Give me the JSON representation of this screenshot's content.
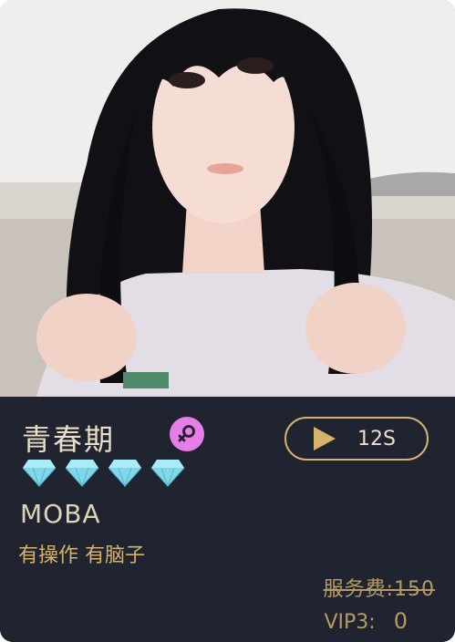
{
  "profile": {
    "name": "青春期",
    "gender_icon": "female-icon",
    "rank_icon": "diamond-icon",
    "rank_count": 4,
    "game": "MOBA",
    "description": "有操作 有脑子"
  },
  "voice": {
    "icon": "play-icon",
    "duration": "12S"
  },
  "pricing": {
    "fee_label": "服务费:",
    "fee_value": "150",
    "vip_label": "VIP3:",
    "vip_value": "0"
  },
  "colors": {
    "panel_bg": "#1f2430",
    "accent_gold": "#d6b26a",
    "title_text": "#eadfc6",
    "diamond": "#7fd7e8",
    "gender_badge": "#e67ee8"
  }
}
